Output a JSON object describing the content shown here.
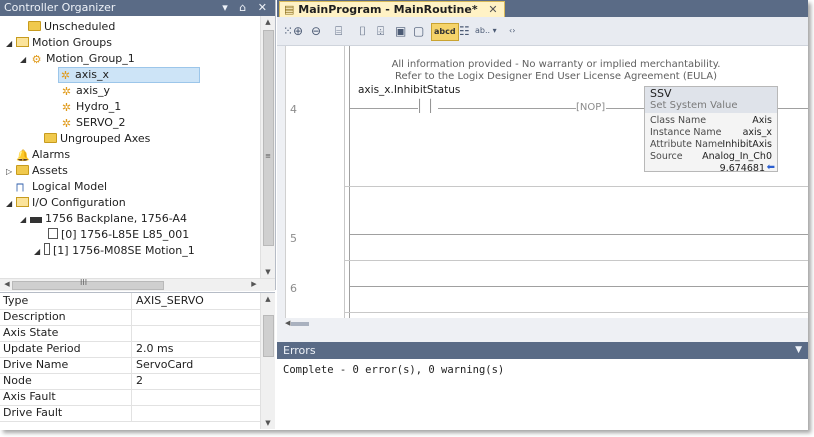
{
  "organizer": {
    "title": "Controller Organizer",
    "controls": "▾ ⌂ ✕",
    "nodes": [
      {
        "label": "Unscheduled",
        "icon": "folder-icon"
      },
      {
        "label": "Motion Groups",
        "icon": "folder-open-icon",
        "expander": "◢"
      },
      {
        "label": "Motion_Group_1",
        "icon": "motion-group-icon",
        "expander": "◢"
      },
      {
        "label": "axis_x",
        "icon": "axis-icon",
        "selected": true
      },
      {
        "label": "axis_y",
        "icon": "axis-icon"
      },
      {
        "label": "Hydro_1",
        "icon": "axis-icon"
      },
      {
        "label": "SERVO_2",
        "icon": "axis-icon"
      },
      {
        "label": "Ungrouped Axes",
        "icon": "folder-icon"
      },
      {
        "label": "Alarms",
        "icon": "bell-icon"
      },
      {
        "label": "Assets",
        "icon": "folder-icon",
        "expander": "▷"
      },
      {
        "label": "Logical Model",
        "icon": "logical-model-icon"
      },
      {
        "label": "I/O Configuration",
        "icon": "folder-open-icon",
        "expander": "◢"
      },
      {
        "label": "1756 Backplane, 1756-A4",
        "icon": "backplane-icon",
        "expander": "◢"
      },
      {
        "label": "[0] 1756-L85E L85_001",
        "icon": "controller-module-icon"
      },
      {
        "label": "[1] 1756-M08SE Motion_1",
        "icon": "motion-module-icon",
        "expander": "◢"
      }
    ],
    "hscroll_glyph": "III"
  },
  "properties": {
    "rows": [
      {
        "key": "Type",
        "value": "AXIS_SERVO"
      },
      {
        "key": "Description",
        "value": ""
      },
      {
        "key": "Axis State",
        "value": ""
      },
      {
        "key": "Update Period",
        "value": "2.0 ms"
      },
      {
        "key": "Drive Name",
        "value": "ServoCard"
      },
      {
        "key": "Node",
        "value": "2"
      },
      {
        "key": "Axis Fault",
        "value": ""
      },
      {
        "key": "Drive Fault",
        "value": ""
      }
    ]
  },
  "editor": {
    "tab_label": "MainProgram - MainRoutine*",
    "tab_close": "✕",
    "toolbar": {
      "zoom_in": "⊕",
      "zoom_out": "⊖",
      "text_mode": "abcd",
      "abc_dropdown": "ab.. ▾",
      "dots": "‹›"
    },
    "notice_line1": "All information provided - No warranty or implied merchantability.",
    "notice_line2": "Refer to the Logix Designer End User License Agreement (EULA)",
    "rungs": [
      "4",
      "5",
      "6"
    ],
    "xic_tag": "axis_x.InhibitStatus",
    "nop_label": "NOP",
    "ssv": {
      "name": "SSV",
      "desc": "Set System Value",
      "rows": [
        {
          "key": "Class Name",
          "value": "Axis"
        },
        {
          "key": "Instance Name",
          "value": "axis_x"
        },
        {
          "key": "Attribute Name",
          "value": "InhibitAxis"
        },
        {
          "key": "Source",
          "value": "Analog_In_Ch0"
        }
      ],
      "source_value": "9.674681"
    }
  },
  "errors": {
    "title": "Errors",
    "text": "Complete - 0 error(s), 0 warning(s)"
  },
  "colors": {
    "title_bar": "#5a6b86",
    "tab_active": "#fff2c5",
    "selection": "#cde4f7"
  }
}
